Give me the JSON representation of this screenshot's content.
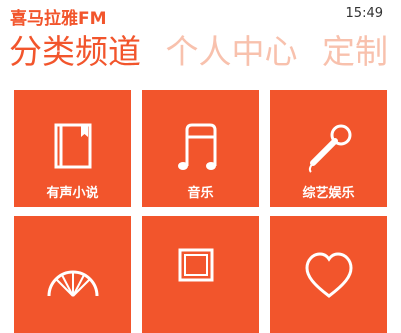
{
  "app": {
    "logo_text": "喜马拉雅FM",
    "clock": "15:49"
  },
  "pivot": {
    "tabs": [
      {
        "label": "分类频道",
        "active": true
      },
      {
        "label": "个人中心",
        "active": false
      },
      {
        "label": "定制",
        "active": false
      }
    ]
  },
  "tiles": [
    {
      "label": "有声小说",
      "icon": "book-icon"
    },
    {
      "label": "音乐",
      "icon": "music-note-icon"
    },
    {
      "label": "综艺娱乐",
      "icon": "microphone-icon"
    },
    {
      "label": "",
      "icon": "radio-wheel-icon"
    },
    {
      "label": "",
      "icon": "picture-frame-icon"
    },
    {
      "label": "",
      "icon": "heart-icon"
    }
  ],
  "colors": {
    "accent": "#f2552c",
    "inactive_tab": "#f8c1ad"
  }
}
